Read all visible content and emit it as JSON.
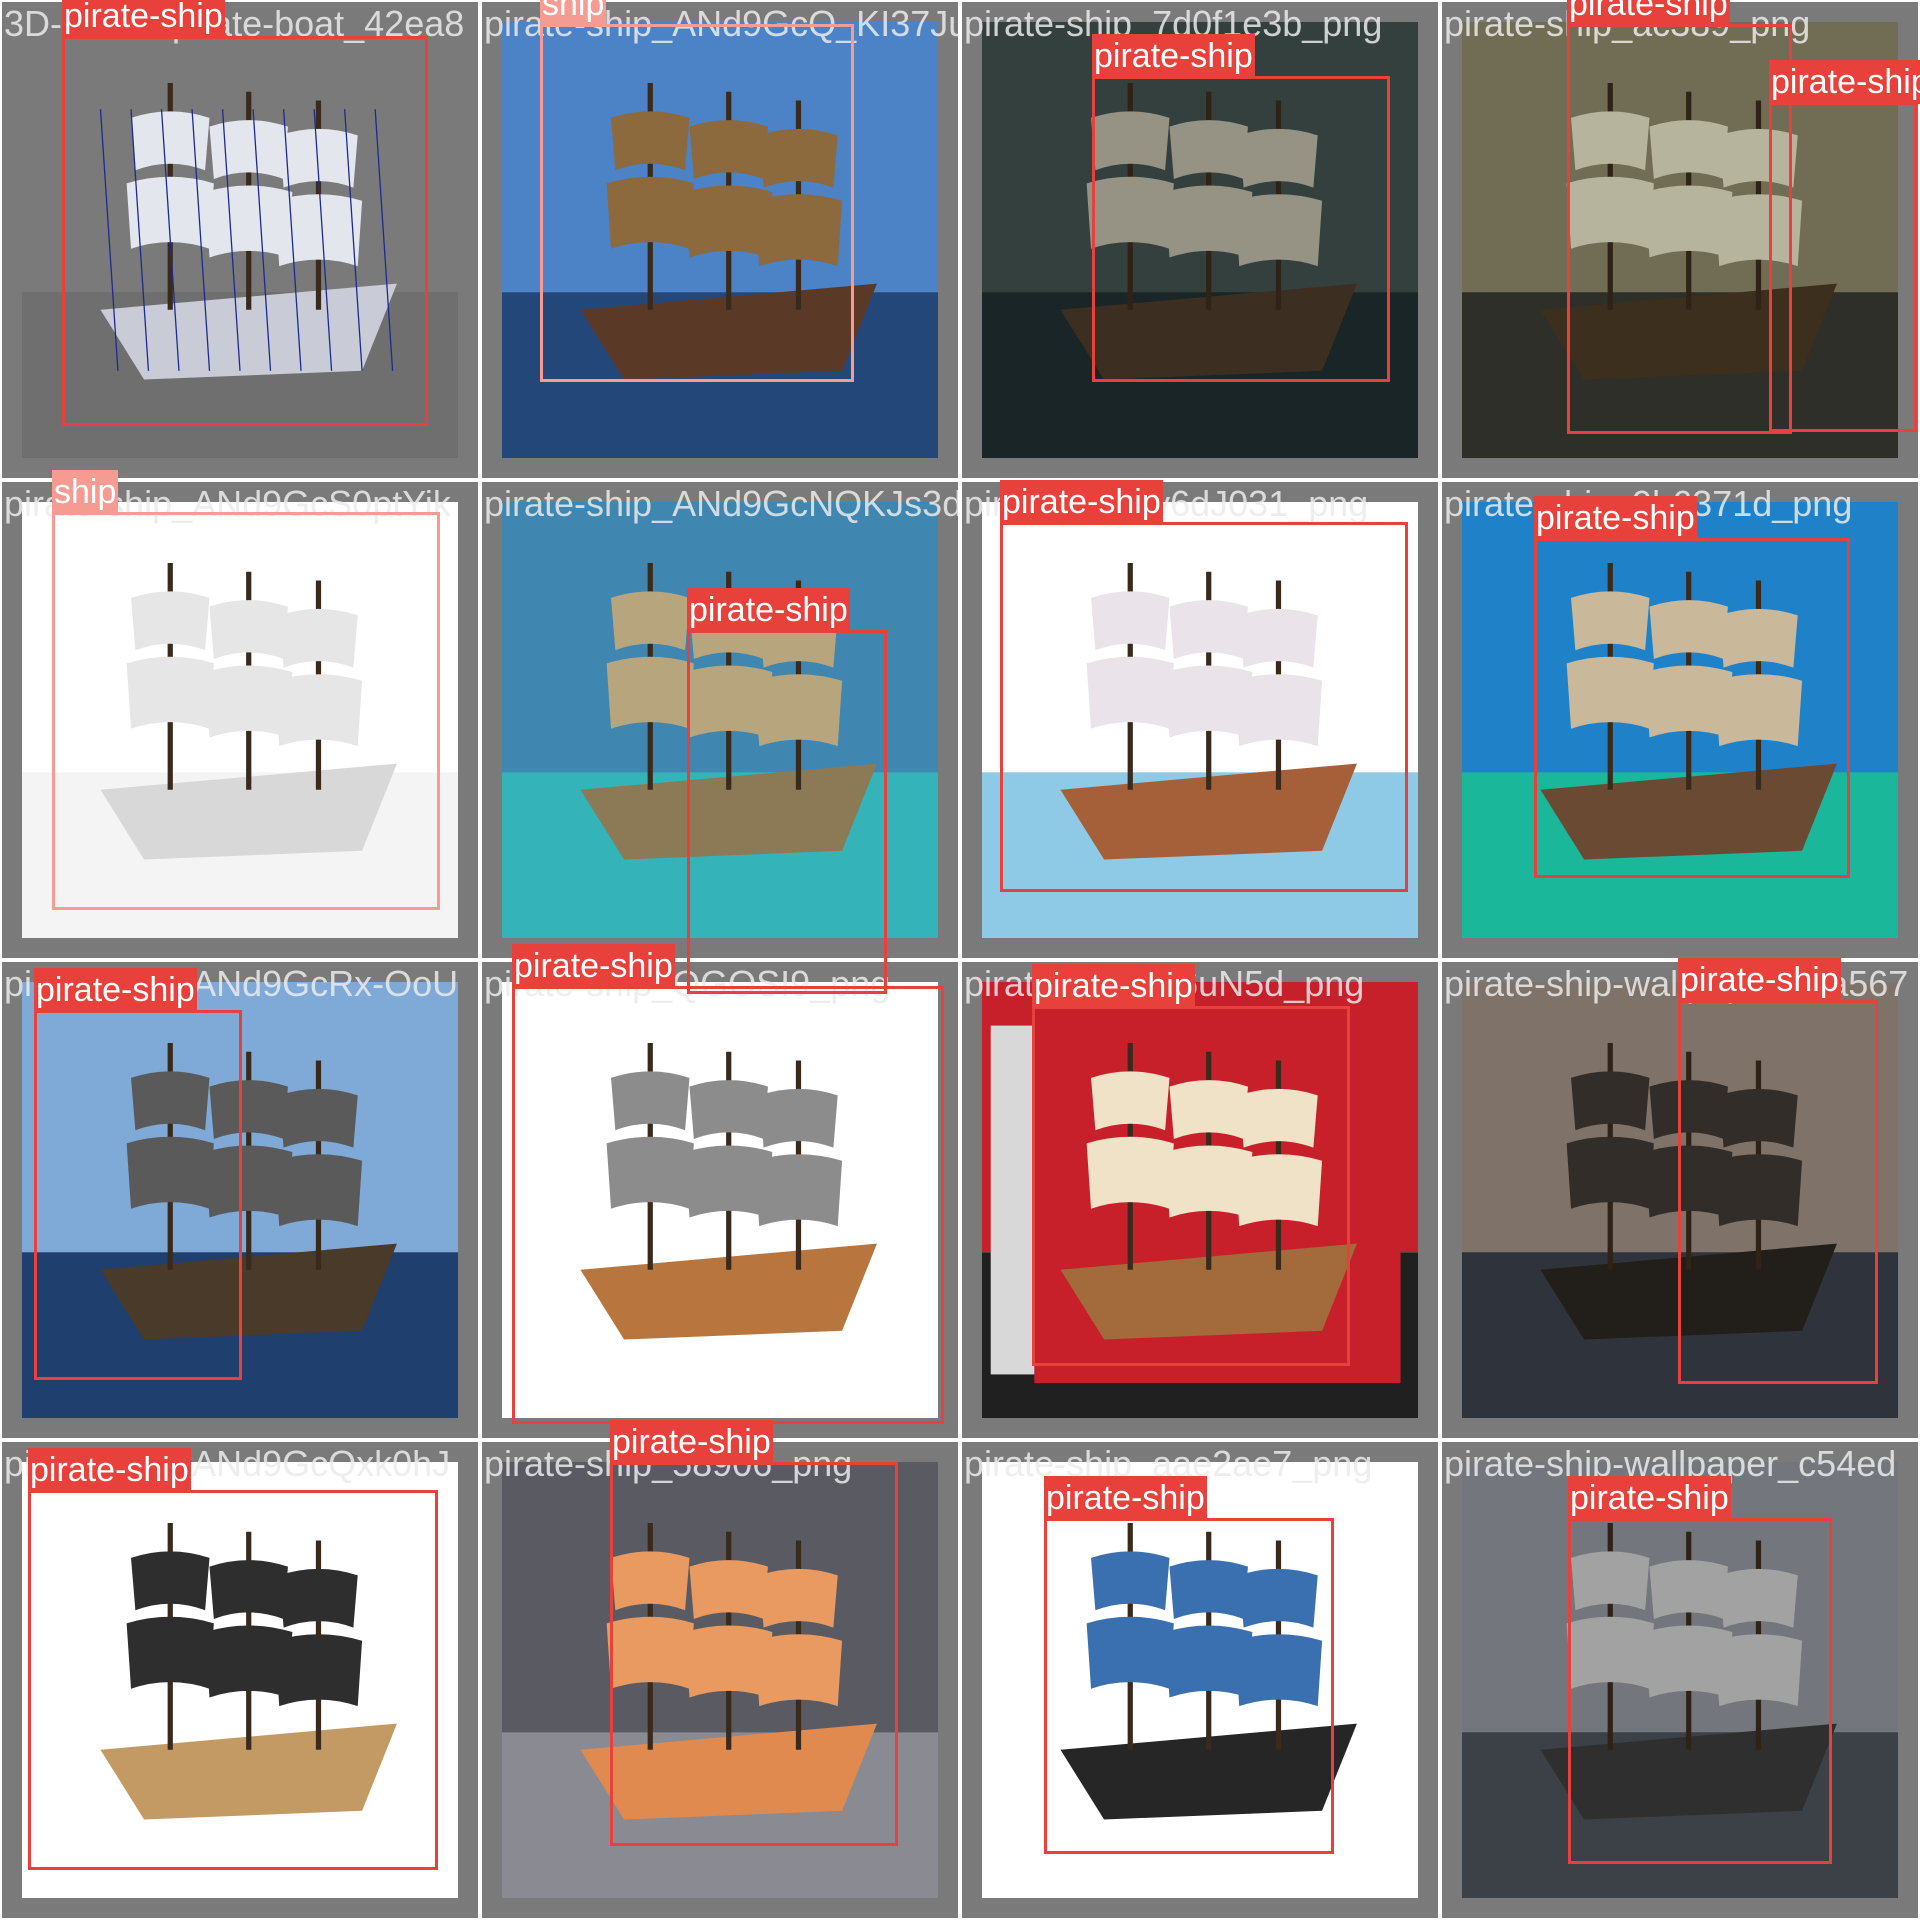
{
  "tiles": [
    {
      "filename": "3D-model-pirate-boat_42ea8",
      "bg": "#6f6f6f",
      "sky": "#7a7a7a",
      "water": "#6f6f6f",
      "hull": "#c9ccd6",
      "sail": "#e4e6ee",
      "kind": "wire",
      "detections": [
        {
          "label": "pirate-ship",
          "tone": "strong"
        }
      ]
    },
    {
      "filename": "pirate-ship_ANd9GcQ_KI37Ju",
      "bg": "#4f6fa0",
      "sky": "#4c82c6",
      "water": "#24477a",
      "hull": "#5a3a26",
      "sail": "#8c6a3e",
      "kind": "photo",
      "detections": [
        {
          "label": "ship",
          "tone": "pale"
        }
      ]
    },
    {
      "filename": "pirate-ship_7d0f1e3b_png",
      "bg": "#2c3a3c",
      "sky": "#3f4f4c",
      "water": "#1f2e2f",
      "hull": "#4a3a2a",
      "sail": "#b8b3a2",
      "kind": "dark",
      "detections": [
        {
          "label": "pirate-ship",
          "tone": "strong"
        }
      ]
    },
    {
      "filename": "pirate-ship_ac389_png",
      "bg": "#4b4b3a",
      "sky": "#8a8667",
      "water": "#3a3a32",
      "hull": "#4a3a25",
      "sail": "#e0dcc0",
      "kind": "dark",
      "detections": [
        {
          "label": "pirate-ship",
          "tone": "strong"
        },
        {
          "label": "pirate-ship",
          "tone": "strong"
        }
      ]
    },
    {
      "filename": "pirate-ship_ANd9GcS0ptYik",
      "bg": "#ffffff",
      "sky": "#ffffff",
      "water": "#f4f4f4",
      "hull": "#d8d8d8",
      "sail": "#e6e6e6",
      "kind": "sketch",
      "detections": [
        {
          "label": "ship",
          "tone": "pale"
        }
      ]
    },
    {
      "filename": "pirate-ship_ANd9GcNQKJs3d",
      "bg": "#3b8fb5",
      "sky": "#3f86b0",
      "water": "#34b3b9",
      "hull": "#8b7a55",
      "sail": "#b7a57e",
      "kind": "photo",
      "detections": [
        {
          "label": "pirate-ship",
          "tone": "strong"
        }
      ]
    },
    {
      "filename": "pirate-ship_y6dJ031_png",
      "bg": "#ffffff",
      "sky": "#ffffff",
      "water": "#8ec9e6",
      "hull": "#a5603a",
      "sail": "#eae3ea",
      "kind": "toy",
      "detections": [
        {
          "label": "pirate-ship",
          "tone": "strong"
        }
      ]
    },
    {
      "filename": "pirate-ship_9b6371d_png",
      "bg": "#1f8bd0",
      "sky": "#1f82c9",
      "water": "#1bb79a",
      "hull": "#6b4a34",
      "sail": "#c9b89a",
      "kind": "photo",
      "detections": [
        {
          "label": "pirate-ship",
          "tone": "strong"
        }
      ]
    },
    {
      "filename": "pirate-ship_ANd9GcRx-OoU",
      "bg": "#5f8fc0",
      "sky": "#7fa9d6",
      "water": "#1f3f6f",
      "hull": "#4a3a2a",
      "sail": "#5a5a5a",
      "kind": "photo",
      "detections": [
        {
          "label": "pirate-ship",
          "tone": "strong"
        }
      ]
    },
    {
      "filename": "pirate-ship_QGOSI9_png",
      "bg": "#ffffff",
      "sky": "#ffffff",
      "water": "#ffffff",
      "hull": "#b8763e",
      "sail": "#8c8c8c",
      "kind": "toy",
      "detections": [
        {
          "label": "pirate-ship",
          "tone": "strong"
        }
      ]
    },
    {
      "filename": "pirate-ship_U6uN5d_png",
      "bg": "#ffffff",
      "sky": "#c8202a",
      "water": "#202020",
      "hull": "#a36a3b",
      "sail": "#f0e2c6",
      "kind": "box",
      "detections": [
        {
          "label": "pirate-ship",
          "tone": "strong"
        }
      ]
    },
    {
      "filename": "pirate-ship-wallpaper_f0a567",
      "bg": "#6a5f5a",
      "sky": "#9b8c80",
      "water": "#3a3f48",
      "hull": "#2a2520",
      "sail": "#3e3832",
      "kind": "dark",
      "detections": [
        {
          "label": "pirate-ship",
          "tone": "strong"
        }
      ]
    },
    {
      "filename": "pirate-ship_ANd9GcQxk0hJ",
      "bg": "#ffffff",
      "sky": "#ffffff",
      "water": "#ffffff",
      "hull": "#c39a64",
      "sail": "#2e2e2e",
      "kind": "model",
      "detections": [
        {
          "label": "pirate-ship",
          "tone": "strong"
        }
      ]
    },
    {
      "filename": "pirate-ship_58906_png",
      "bg": "#4b4b52",
      "sky": "#5a5a63",
      "water": "#8a8a92",
      "hull": "#e08a50",
      "sail": "#e89a60",
      "kind": "mini",
      "detections": [
        {
          "label": "pirate-ship",
          "tone": "strong"
        }
      ]
    },
    {
      "filename": "pirate-ship_aae2ae7_png",
      "bg": "#ffffff",
      "sky": "#ffffff",
      "water": "#ffffff",
      "hull": "#262626",
      "sail": "#3a6fb0",
      "kind": "toy",
      "detections": [
        {
          "label": "pirate-ship",
          "tone": "strong"
        }
      ]
    },
    {
      "filename": "pirate-ship-wallpaper_c54ed",
      "bg": "#5b6066",
      "sky": "#8d9299",
      "water": "#4a5058",
      "hull": "#3a3a3a",
      "sail": "#c6c6c6",
      "kind": "dark",
      "detections": [
        {
          "label": "pirate-ship",
          "tone": "strong"
        }
      ]
    }
  ]
}
